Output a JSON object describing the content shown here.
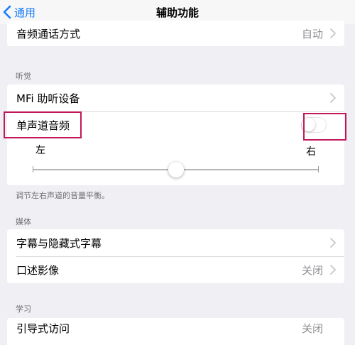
{
  "nav": {
    "back_label": "通用",
    "title": "辅助功能"
  },
  "rows": {
    "audio_routing": {
      "label": "音频通话方式",
      "value": "自动"
    },
    "mfi": {
      "label": "MFi 助听设备"
    },
    "mono": {
      "label": "单声道音频",
      "on": false
    },
    "subtitles": {
      "label": "字幕与隐藏式字幕"
    },
    "audio_desc": {
      "label": "口述影像",
      "value": "关闭"
    },
    "guided": {
      "label": "引导式访问",
      "value": "关闭"
    }
  },
  "sections": {
    "hearing": "听觉",
    "media": "媒体",
    "learning": "学习"
  },
  "balance": {
    "left": "左",
    "right": "右",
    "position": 0.5,
    "footnote": "调节左右声道的音量平衡。"
  },
  "colors": {
    "accent": "#157efb",
    "highlight": "#c2185b",
    "background": "#efeff4"
  }
}
